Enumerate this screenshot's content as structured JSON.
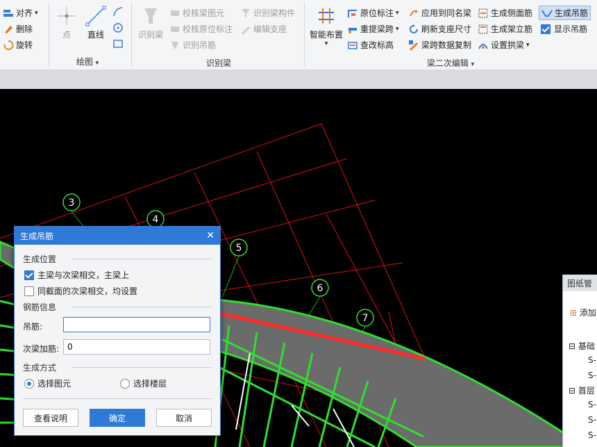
{
  "ribbon": {
    "left_group": {
      "align": "对齐",
      "delete": "删除",
      "rotate": "旋转"
    },
    "draw_group": {
      "point": "点",
      "line": "直线",
      "label": "绘图"
    },
    "recognize_group": {
      "recognize_beam": "识别梁",
      "check_beam_elem": "校核梁图元",
      "check_orig_label": "校核原位标注",
      "recognize_hanger": "识别吊筋",
      "recognize_beam_member": "识别梁构件",
      "edit_support": "编辑支座",
      "label": "识别梁"
    },
    "secondary_group": {
      "smart_layout": "智能布置",
      "orig_label": "原位标注",
      "re_extract_span": "重提梁跨",
      "check_elevation": "查改标高",
      "apply_same_name": "应用到同名梁",
      "refresh_support": "刷新支座尺寸",
      "span_copy": "梁跨数据复制",
      "gen_side_rebar": "生成侧面筋",
      "gen_erect_rebar": "生成架立筋",
      "set_arch_beam": "设置拱梁",
      "gen_hanger": "生成吊筋",
      "show_hanger": "显示吊筋",
      "label": "梁二次编辑"
    }
  },
  "axis_markers": [
    "3",
    "4",
    "5",
    "6",
    "7"
  ],
  "dialog": {
    "title": "生成吊筋",
    "section_position": "生成位置",
    "option_main_secondary": "主梁与次梁相交，主梁上",
    "option_main_secondary_checked": true,
    "option_same_section": "同截面的次梁相交，均设置",
    "option_same_section_checked": false,
    "section_rebar": "钢筋信息",
    "hanger_label": "吊筋:",
    "hanger_value": "",
    "secondary_label": "次梁加筋:",
    "secondary_value": "0",
    "section_method": "生成方式",
    "radio_select_elem": "选择图元",
    "radio_select_floor": "选择楼层",
    "selected_method": "选择图元",
    "btn_help": "查看说明",
    "btn_ok": "确定",
    "btn_cancel": "取消"
  },
  "side_panel": {
    "title": "图纸管",
    "add": "添加",
    "tree": [
      "基础",
      "S-",
      "S-",
      "首层",
      "S-",
      "S-",
      "S-"
    ]
  }
}
